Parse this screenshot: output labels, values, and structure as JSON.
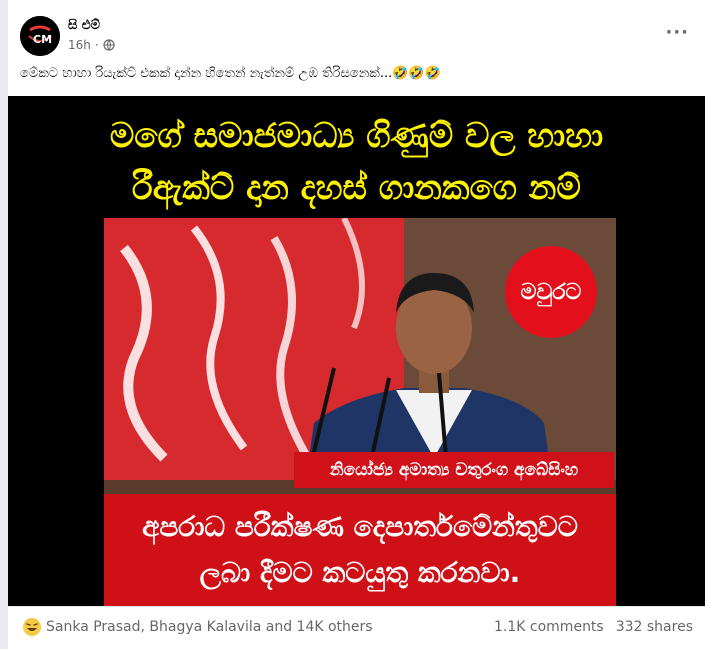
{
  "post": {
    "author": "සි එම්",
    "time": "16h",
    "audience_icon": "globe-icon",
    "caption": "මේකට හාහා රියැක්ට් එකක් දාන්න හිතෙන් නැත්නම් උඹ තිරිසනෙක්...🤣🤣🤣",
    "more_icon": "more-dots-icon"
  },
  "media": {
    "headline_line1": "මගේ සමාජමාධ්‍ය ගිණුම් වල හාහා",
    "headline_line2": "රීඇක්ට් දාන දහස් ගානකගෙ නම්",
    "badge": "මවුරට",
    "name_tag": "නියෝජ්‍ය අමාත්‍ය චතුරංග අබේසිංහ",
    "bottom_line1": "අපරාධ පරීක්ෂණ දෙපාර්තමේන්තුවට",
    "bottom_line2": "ලබා දීමට කටයුතු කරනවා."
  },
  "footer": {
    "reaction_icon": "haha-reaction-icon",
    "reactors": "Sanka Prasad, Bhagya Kalavila and 14K others",
    "comments": "1.1K comments",
    "shares": "332 shares"
  },
  "colors": {
    "headline_yellow": "#fff200",
    "brand_red": "#d0111a",
    "meta_gray": "#65676b"
  }
}
